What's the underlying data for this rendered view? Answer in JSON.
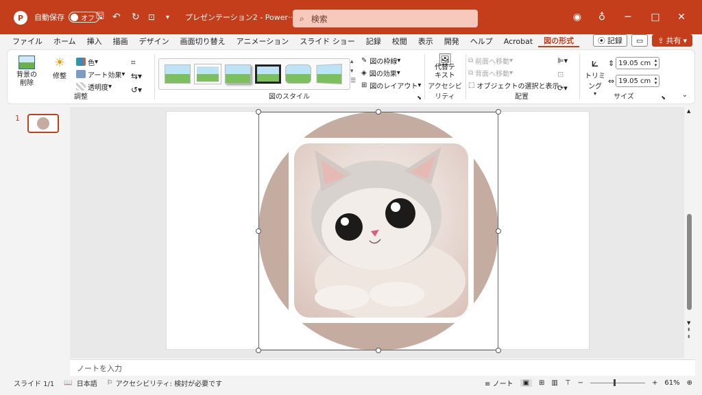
{
  "titlebar": {
    "autosave_label": "自動保存",
    "autosave_state": "オフ",
    "doc_title": "プレゼンテーション2 - Power···",
    "search_placeholder": "検索"
  },
  "menu": {
    "items": [
      "ファイル",
      "ホーム",
      "挿入",
      "描画",
      "デザイン",
      "画面切り替え",
      "アニメーション",
      "スライド ショー",
      "記録",
      "校閲",
      "表示",
      "開発",
      "ヘルプ",
      "Acrobat",
      "図の形式"
    ],
    "active": "図の形式",
    "record_label": "記録",
    "share_label": "共有"
  },
  "ribbon": {
    "adjust": {
      "remove_bg": "背景の削除",
      "correct": "修整",
      "color": "色",
      "art_effects": "アート効果",
      "transparency": "透明度",
      "group_label": "調整"
    },
    "styles": {
      "border": "図の枠線",
      "effects": "図の効果",
      "layout": "図のレイアウト",
      "group_label": "図のスタイル"
    },
    "accessibility": {
      "alt_text": "代替テキスト",
      "group_label": "アクセシビリティ"
    },
    "arrange": {
      "bring_forward": "前面へ移動",
      "send_backward": "背面へ移動",
      "selection_pane": "オブジェクトの選択と表示",
      "group_label": "配置"
    },
    "size": {
      "crop": "トリミング",
      "height": "19.05 cm",
      "width": "19.05 cm",
      "group_label": "サイズ"
    }
  },
  "thumbs": {
    "slide_number": "1"
  },
  "notes_placeholder": "ノートを入力",
  "status": {
    "slide": "スライド 1/1",
    "language": "日本語",
    "accessibility": "アクセシビリティ: 検討が必要です",
    "notes": "ノート",
    "zoom": "61%"
  },
  "colors": {
    "accent": "#c43e1c"
  }
}
